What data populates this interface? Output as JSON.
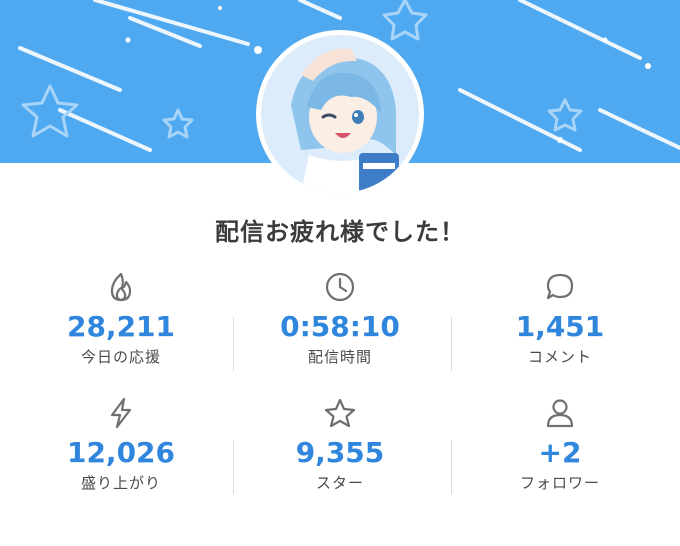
{
  "banner": {
    "background_color": "#4fa9f1"
  },
  "headline": "配信お疲れ様でした！",
  "stats": [
    {
      "icon": "fire-icon",
      "value": "28,211",
      "label": "今日の応援"
    },
    {
      "icon": "clock-icon",
      "value": "0:58:10",
      "label": "配信時間"
    },
    {
      "icon": "comment-bubble-icon",
      "value": "1,451",
      "label": "コメント"
    },
    {
      "icon": "lightning-icon",
      "value": "12,026",
      "label": "盛り上がり"
    },
    {
      "icon": "star-icon",
      "value": "9,355",
      "label": "スター"
    },
    {
      "icon": "person-icon",
      "value": "+2",
      "label": "フォロワー"
    }
  ],
  "colors": {
    "accent": "#2f86dc",
    "headline": "#3c3c3c",
    "label": "#4a4a4a",
    "icon": "#707070"
  }
}
